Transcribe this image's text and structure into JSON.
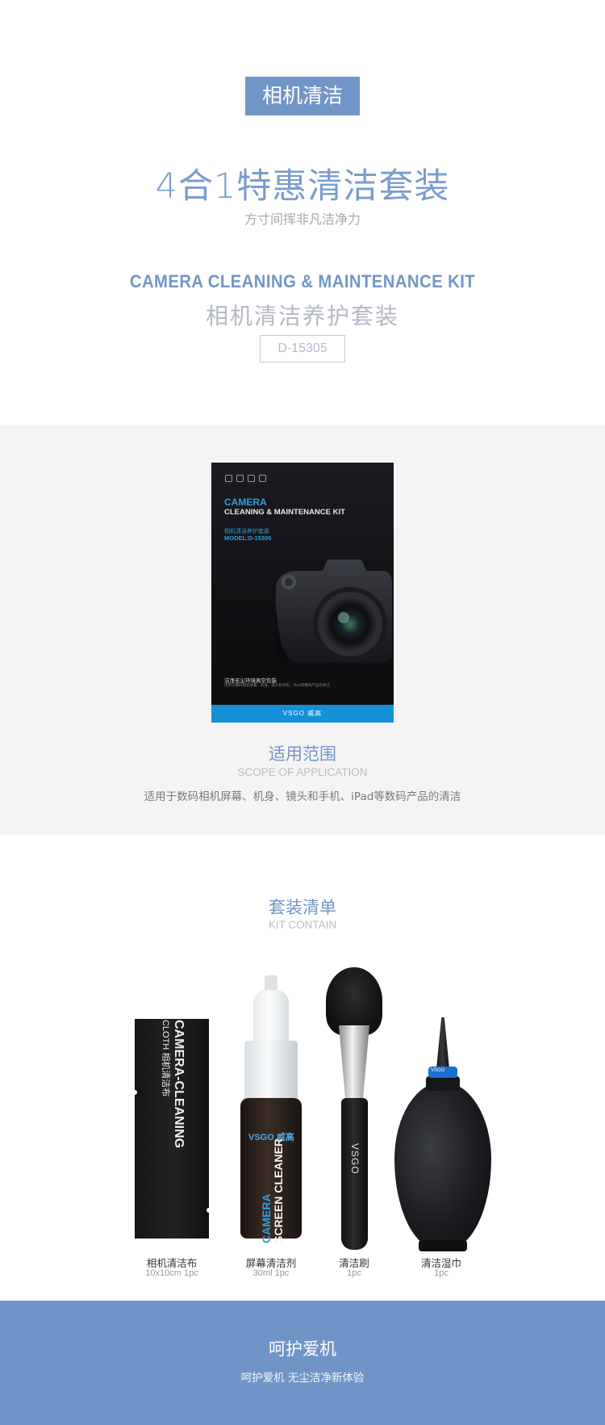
{
  "hero": {
    "tag": "相机清洁",
    "headline": "4合1特惠清洁套装",
    "headline_sub": "方寸间挥非凡洁净力",
    "en_title": "CAMERA CLEANING & MAINTENANCE KIT",
    "cn_title": "相机清洁养护套装",
    "model": "D-15305"
  },
  "package": {
    "line1": "CAMERA",
    "line2": "CLEANING & MAINTENANCE KIT",
    "line3": "相机清洁养护套装",
    "line4": "MODEL:D-15305",
    "foot": "洁净无尘环境真空包装",
    "foot_small": "适用于数码相机屏幕、机身、镜头和手机、iPad等数码产品的清洁",
    "brand": "VSGO 威高"
  },
  "scope": {
    "title": "适用范围",
    "en": "SCOPE OF APPLICATION",
    "desc": "适用于数码相机屏幕、机身、镜头和手机、iPad等数码产品的清洁"
  },
  "kit": {
    "title": "套装清单",
    "en": "KIT CONTAIN",
    "items": [
      {
        "name": "相机清洁布",
        "spec": "10x10cm 1pc",
        "pack_text1": "CAMERA-CLEANING",
        "pack_text2": "CLOTH 相机清洁布"
      },
      {
        "name": "屏幕清洁剂",
        "spec": "30ml 1pc",
        "logo": "VSGO 威高",
        "text1": "CAMERA",
        "text2": "SCREEN CLEANER"
      },
      {
        "name": "清洁刷",
        "spec": "1pc",
        "logo": "VSGO"
      },
      {
        "name": "清洁湿巾",
        "spec": "1pc",
        "logo": "VSGO"
      }
    ]
  },
  "footer": {
    "title": "呵护爱机",
    "sub": "呵护爱机 无尘洁净新体验"
  },
  "colors": {
    "accent": "#7395c7",
    "brand_blue": "#1590d8"
  }
}
